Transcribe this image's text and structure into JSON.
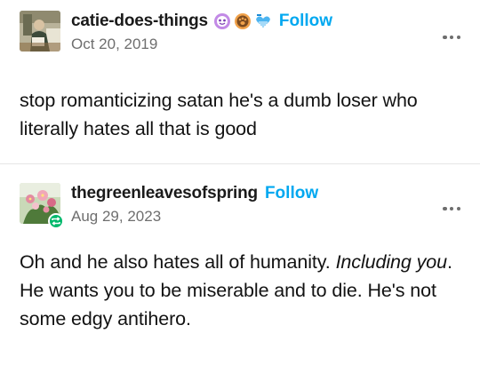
{
  "posts": [
    {
      "username": "catie-does-things",
      "follow_label": "Follow",
      "date": "Oct 20, 2019",
      "avatar_icon": "painting-avatar",
      "badges": [
        "purple-sticker-badge-icon",
        "orange-paw-badge-icon",
        "blue-heart-badge-icon"
      ],
      "body": "stop romanticizing satan he's a dumb loser who literally hates all that is good"
    },
    {
      "username": "thegreenleavesofspring",
      "follow_label": "Follow",
      "date": "Aug 29, 2023",
      "avatar_icon": "flowers-avatar",
      "reblog_icon": "reblog-icon",
      "body_line1": "Oh and he also hates all of humanity.",
      "body_em": "Including you",
      "body_line2_rest": ". He wants you to be miserable and to die. He's not some edgy antihero."
    }
  ],
  "colors": {
    "follow": "#00a8f0",
    "date": "#6e6e6e",
    "reblog_badge": "#00b86b"
  }
}
